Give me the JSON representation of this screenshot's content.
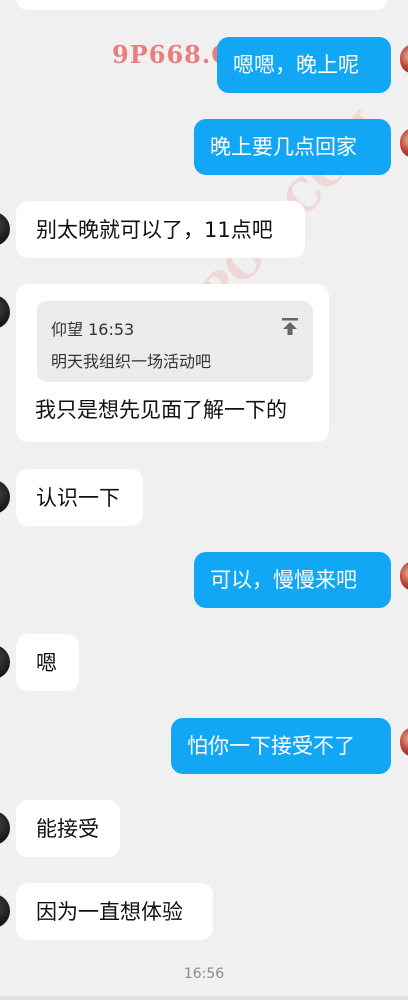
{
  "messages": [
    {
      "id": "m1",
      "side": "right",
      "text": "嗯嗯，晚上呢"
    },
    {
      "id": "m2",
      "side": "right",
      "text": "晚上要几点回家"
    },
    {
      "id": "m3",
      "side": "left",
      "text": "别太晚就可以了，11点吧"
    },
    {
      "id": "m4",
      "side": "left",
      "text": "我只是想先见面了解一下的",
      "quote": {
        "header": "仰望 16:53",
        "text": "明天我组织一场活动吧"
      }
    },
    {
      "id": "m5",
      "side": "left",
      "text": "认识一下"
    },
    {
      "id": "m6",
      "side": "right",
      "text": "可以，慢慢来吧"
    },
    {
      "id": "m7",
      "side": "left",
      "text": "嗯"
    },
    {
      "id": "m8",
      "side": "right",
      "text": "怕你一下接受不了"
    },
    {
      "id": "m9",
      "side": "left",
      "text": "能接受"
    },
    {
      "id": "m10",
      "side": "left",
      "text": "因为一直想体验"
    }
  ],
  "timestamp": "16:56",
  "watermarks": {
    "top": "9P668.COM",
    "diagonal": "91POR.COM"
  },
  "colors": {
    "outgoing_bubble": "#12a7f5",
    "incoming_bubble": "#ffffff",
    "background": "#f0f0f0"
  }
}
